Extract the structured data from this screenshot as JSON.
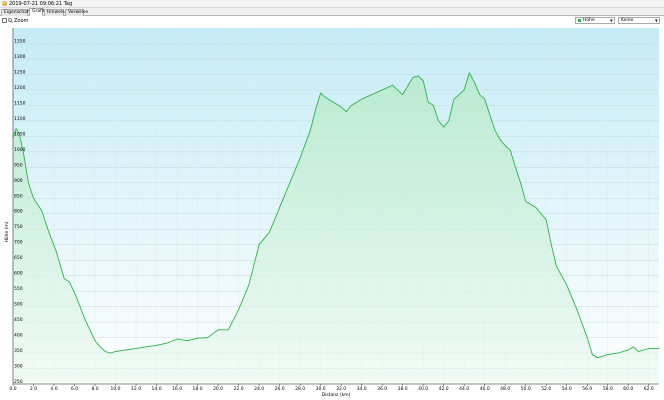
{
  "window": {
    "title": "2019-07-21 09:06:21 Tag"
  },
  "tabs": [
    {
      "label": "Eigenschaften",
      "active": false
    },
    {
      "label": "Grafik",
      "active": true
    },
    {
      "label": "Hinweise",
      "active": false
    },
    {
      "label": "Verweise",
      "active": false
    }
  ],
  "toolbar": {
    "zoom_label": "Zoom",
    "legend_value": "Höhe",
    "name_value": "Keine"
  },
  "colors": {
    "series": "#2db34a",
    "plot_bg_top": "#c6ecf7",
    "plot_bg_bottom": "#ffffff"
  },
  "chart_data": {
    "type": "area",
    "xlabel": "Distanz (km)",
    "ylabel": "Höhe (m)",
    "xlim": [
      0,
      63
    ],
    "ylim": [
      250,
      1400
    ],
    "grid": true,
    "legend": "top-right",
    "x_ticks": [
      "0.0",
      "2.0",
      "4.0",
      "6.0",
      "8.0",
      "10.0",
      "12.0",
      "14.0",
      "16.0",
      "18.0",
      "20.0",
      "22.0",
      "24.0",
      "26.0",
      "28.0",
      "30.0",
      "32.0",
      "34.0",
      "36.0",
      "38.0",
      "40.0",
      "42.0",
      "44.0",
      "46.0",
      "48.0",
      "50.0",
      "52.0",
      "54.0",
      "56.0",
      "58.0",
      "60.0",
      "62.0"
    ],
    "y_ticks": [
      "250",
      "300",
      "350",
      "400",
      "450",
      "500",
      "550",
      "600",
      "650",
      "700",
      "750",
      "800",
      "850",
      "900",
      "950",
      "1000",
      "1050",
      "1100",
      "1150",
      "1200",
      "1250",
      "1300",
      "1350"
    ],
    "series": [
      {
        "name": "Höhe",
        "x": [
          0,
          0.3,
          0.6,
          1.0,
          1.5,
          2.0,
          2.8,
          3.5,
          4.2,
          5.0,
          5.5,
          6.2,
          7.0,
          8.0,
          8.5,
          9.0,
          9.5,
          10.0,
          11.0,
          12.0,
          13.0,
          14.0,
          15.0,
          16.0,
          17.0,
          18.0,
          19.0,
          20.0,
          21.0,
          22.0,
          23.0,
          24.0,
          25.0,
          26.0,
          27.0,
          28.0,
          29.0,
          29.5,
          30.0,
          30.5,
          31.0,
          32.0,
          32.5,
          33.0,
          34.0,
          35.0,
          36.0,
          37.0,
          38.0,
          39.0,
          39.5,
          40.0,
          40.5,
          41.0,
          41.5,
          42.0,
          42.5,
          43.0,
          43.5,
          44.0,
          44.5,
          45.0,
          45.5,
          46.0,
          46.5,
          47.0,
          47.5,
          48.0,
          48.5,
          49.0,
          49.5,
          50.0,
          51.0,
          52.0,
          52.5,
          53.0,
          54.0,
          55.0,
          55.5,
          56.0,
          56.5,
          57.0,
          57.5,
          58.0,
          59.0,
          60.0,
          60.5,
          61.0,
          62.0,
          63.0
        ],
        "values": [
          1045,
          1075,
          1060,
          1000,
          900,
          850,
          810,
          740,
          680,
          590,
          580,
          530,
          460,
          390,
          370,
          355,
          350,
          355,
          360,
          365,
          370,
          375,
          382,
          395,
          390,
          398,
          400,
          425,
          425,
          490,
          570,
          700,
          740,
          820,
          900,
          980,
          1070,
          1135,
          1190,
          1175,
          1165,
          1145,
          1130,
          1150,
          1170,
          1185,
          1200,
          1215,
          1185,
          1240,
          1245,
          1230,
          1160,
          1150,
          1100,
          1080,
          1100,
          1170,
          1185,
          1200,
          1255,
          1225,
          1185,
          1170,
          1120,
          1070,
          1040,
          1020,
          1005,
          950,
          900,
          840,
          820,
          780,
          700,
          630,
          570,
          490,
          445,
          400,
          345,
          335,
          340,
          345,
          350,
          360,
          370,
          355,
          365,
          365
        ]
      }
    ]
  }
}
